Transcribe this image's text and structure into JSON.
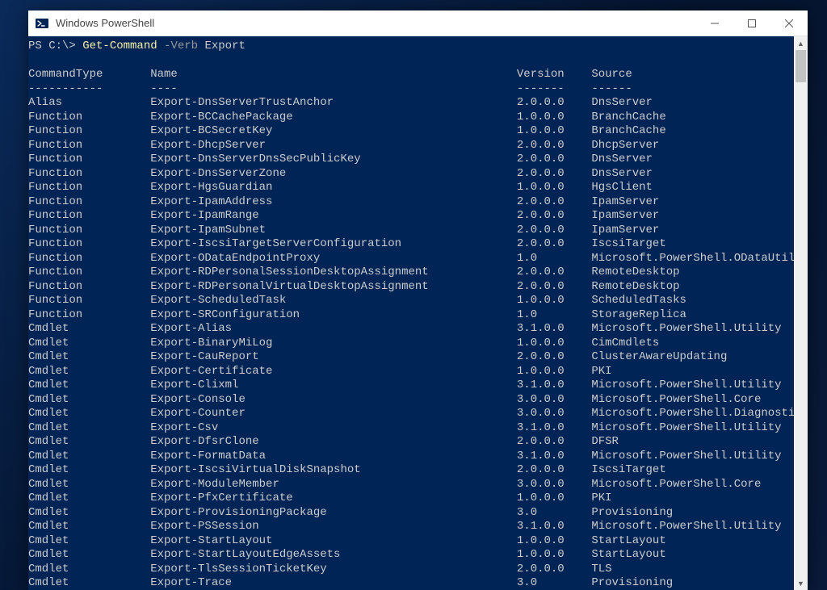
{
  "window": {
    "title": "Windows PowerShell"
  },
  "prompt": {
    "prefix": "PS C:\\>",
    "cmd": "Get-Command",
    "param": "-Verb",
    "arg": "Export"
  },
  "columns": {
    "c1": "CommandType",
    "c2": "Name",
    "c3": "Version",
    "c4": "Source",
    "d1": "-----------",
    "d2": "----",
    "d3": "-------",
    "d4": "------"
  },
  "widths": {
    "c1": 18,
    "c2": 54,
    "c3": 11
  },
  "rows": [
    {
      "t": "Alias",
      "n": "Export-DnsServerTrustAnchor",
      "v": "2.0.0.0",
      "s": "DnsServer"
    },
    {
      "t": "Function",
      "n": "Export-BCCachePackage",
      "v": "1.0.0.0",
      "s": "BranchCache"
    },
    {
      "t": "Function",
      "n": "Export-BCSecretKey",
      "v": "1.0.0.0",
      "s": "BranchCache"
    },
    {
      "t": "Function",
      "n": "Export-DhcpServer",
      "v": "2.0.0.0",
      "s": "DhcpServer"
    },
    {
      "t": "Function",
      "n": "Export-DnsServerDnsSecPublicKey",
      "v": "2.0.0.0",
      "s": "DnsServer"
    },
    {
      "t": "Function",
      "n": "Export-DnsServerZone",
      "v": "2.0.0.0",
      "s": "DnsServer"
    },
    {
      "t": "Function",
      "n": "Export-HgsGuardian",
      "v": "1.0.0.0",
      "s": "HgsClient"
    },
    {
      "t": "Function",
      "n": "Export-IpamAddress",
      "v": "2.0.0.0",
      "s": "IpamServer"
    },
    {
      "t": "Function",
      "n": "Export-IpamRange",
      "v": "2.0.0.0",
      "s": "IpamServer"
    },
    {
      "t": "Function",
      "n": "Export-IpamSubnet",
      "v": "2.0.0.0",
      "s": "IpamServer"
    },
    {
      "t": "Function",
      "n": "Export-IscsiTargetServerConfiguration",
      "v": "2.0.0.0",
      "s": "IscsiTarget"
    },
    {
      "t": "Function",
      "n": "Export-ODataEndpointProxy",
      "v": "1.0",
      "s": "Microsoft.PowerShell.ODataUtils"
    },
    {
      "t": "Function",
      "n": "Export-RDPersonalSessionDesktopAssignment",
      "v": "2.0.0.0",
      "s": "RemoteDesktop"
    },
    {
      "t": "Function",
      "n": "Export-RDPersonalVirtualDesktopAssignment",
      "v": "2.0.0.0",
      "s": "RemoteDesktop"
    },
    {
      "t": "Function",
      "n": "Export-ScheduledTask",
      "v": "1.0.0.0",
      "s": "ScheduledTasks"
    },
    {
      "t": "Function",
      "n": "Export-SRConfiguration",
      "v": "1.0",
      "s": "StorageReplica"
    },
    {
      "t": "Cmdlet",
      "n": "Export-Alias",
      "v": "3.1.0.0",
      "s": "Microsoft.PowerShell.Utility"
    },
    {
      "t": "Cmdlet",
      "n": "Export-BinaryMiLog",
      "v": "1.0.0.0",
      "s": "CimCmdlets"
    },
    {
      "t": "Cmdlet",
      "n": "Export-CauReport",
      "v": "2.0.0.0",
      "s": "ClusterAwareUpdating"
    },
    {
      "t": "Cmdlet",
      "n": "Export-Certificate",
      "v": "1.0.0.0",
      "s": "PKI"
    },
    {
      "t": "Cmdlet",
      "n": "Export-Clixml",
      "v": "3.1.0.0",
      "s": "Microsoft.PowerShell.Utility"
    },
    {
      "t": "Cmdlet",
      "n": "Export-Console",
      "v": "3.0.0.0",
      "s": "Microsoft.PowerShell.Core"
    },
    {
      "t": "Cmdlet",
      "n": "Export-Counter",
      "v": "3.0.0.0",
      "s": "Microsoft.PowerShell.Diagnostics"
    },
    {
      "t": "Cmdlet",
      "n": "Export-Csv",
      "v": "3.1.0.0",
      "s": "Microsoft.PowerShell.Utility"
    },
    {
      "t": "Cmdlet",
      "n": "Export-DfsrClone",
      "v": "2.0.0.0",
      "s": "DFSR"
    },
    {
      "t": "Cmdlet",
      "n": "Export-FormatData",
      "v": "3.1.0.0",
      "s": "Microsoft.PowerShell.Utility"
    },
    {
      "t": "Cmdlet",
      "n": "Export-IscsiVirtualDiskSnapshot",
      "v": "2.0.0.0",
      "s": "IscsiTarget"
    },
    {
      "t": "Cmdlet",
      "n": "Export-ModuleMember",
      "v": "3.0.0.0",
      "s": "Microsoft.PowerShell.Core"
    },
    {
      "t": "Cmdlet",
      "n": "Export-PfxCertificate",
      "v": "1.0.0.0",
      "s": "PKI"
    },
    {
      "t": "Cmdlet",
      "n": "Export-ProvisioningPackage",
      "v": "3.0",
      "s": "Provisioning"
    },
    {
      "t": "Cmdlet",
      "n": "Export-PSSession",
      "v": "3.1.0.0",
      "s": "Microsoft.PowerShell.Utility"
    },
    {
      "t": "Cmdlet",
      "n": "Export-StartLayout",
      "v": "1.0.0.0",
      "s": "StartLayout"
    },
    {
      "t": "Cmdlet",
      "n": "Export-StartLayoutEdgeAssets",
      "v": "1.0.0.0",
      "s": "StartLayout"
    },
    {
      "t": "Cmdlet",
      "n": "Export-TlsSessionTicketKey",
      "v": "2.0.0.0",
      "s": "TLS"
    },
    {
      "t": "Cmdlet",
      "n": "Export-Trace",
      "v": "3.0",
      "s": "Provisioning"
    }
  ]
}
